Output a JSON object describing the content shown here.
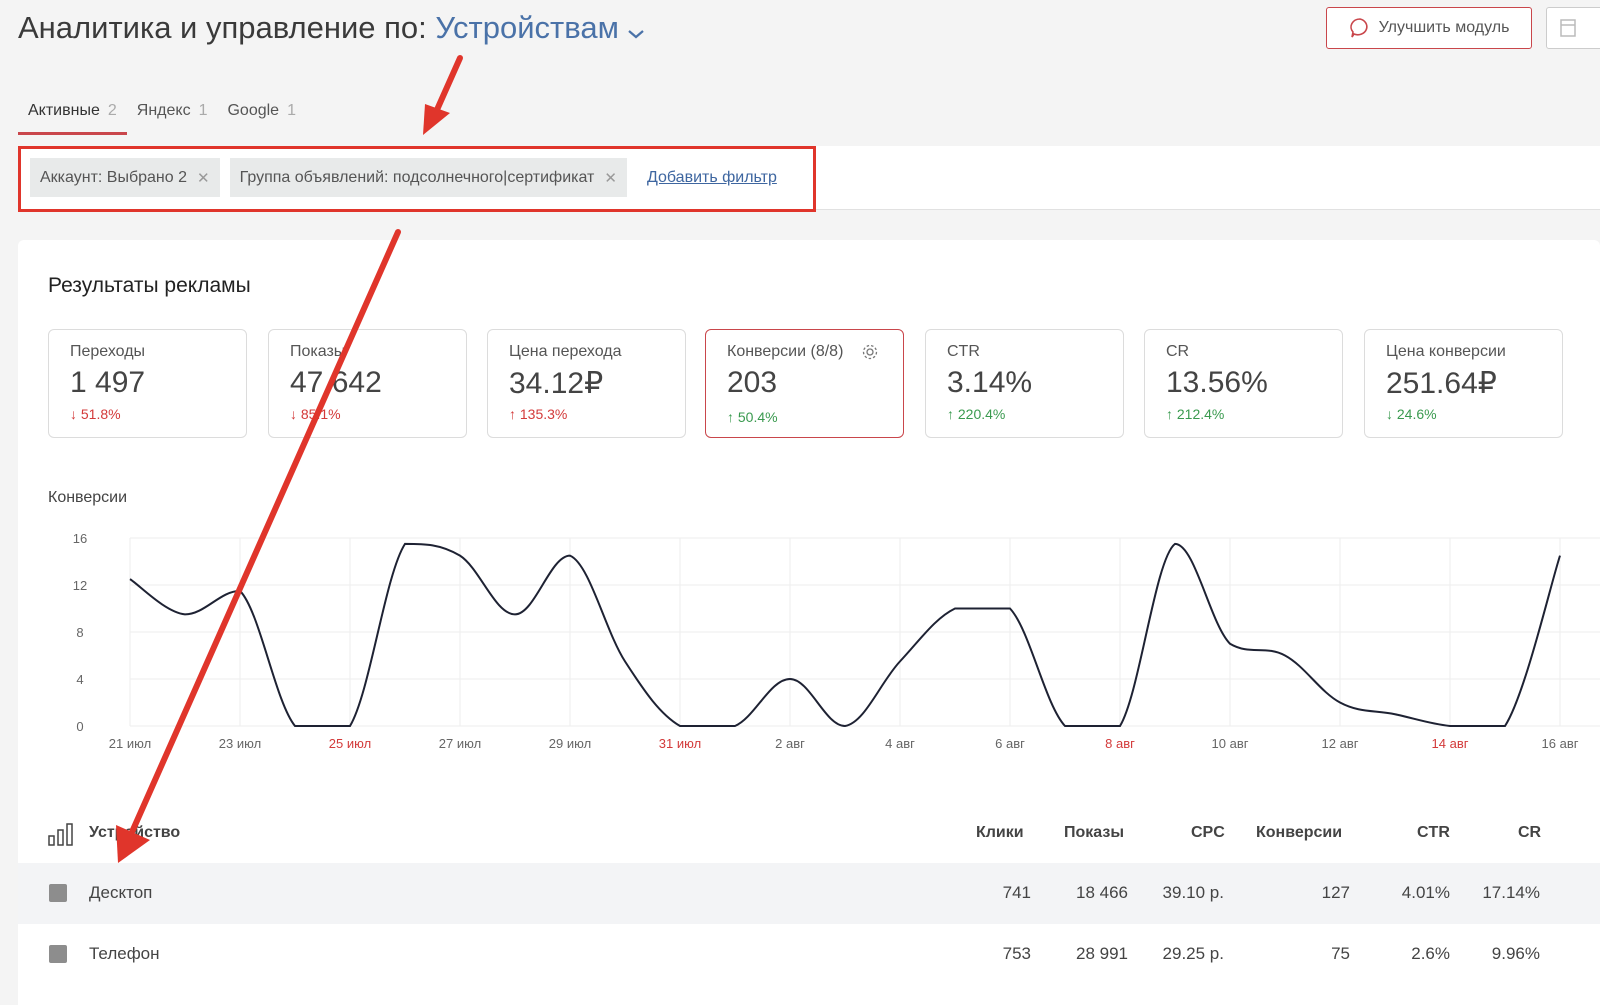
{
  "header": {
    "title_prefix": "Аналитика и управление по:",
    "dimension": "Устройствам",
    "improve_button": "Улучшить модуль"
  },
  "tabs": [
    {
      "label": "Активные",
      "count": "2"
    },
    {
      "label": "Яндекс",
      "count": "1"
    },
    {
      "label": "Google",
      "count": "1"
    }
  ],
  "filters": {
    "chips": [
      "Аккаунт: Выбрано 2",
      "Группа объявлений: подсолнечного|сертификат"
    ],
    "add_label": "Добавить фильтр"
  },
  "results": {
    "title": "Результаты рекламы",
    "kpis": [
      {
        "label": "Переходы",
        "value": "1 497",
        "delta": "51.8%",
        "dir": "down"
      },
      {
        "label": "Показы",
        "value": "47 642",
        "delta": "85.1%",
        "dir": "down"
      },
      {
        "label": "Цена перехода",
        "value": "34.12₽",
        "delta": "135.3%",
        "dir": "up_red"
      },
      {
        "label": "Конверсии (8/8)",
        "value": "203",
        "delta": "50.4%",
        "dir": "up"
      },
      {
        "label": "CTR",
        "value": "3.14%",
        "delta": "220.4%",
        "dir": "up"
      },
      {
        "label": "CR",
        "value": "13.56%",
        "delta": "212.4%",
        "dir": "up"
      },
      {
        "label": "Цена конверсии",
        "value": "251.64₽",
        "delta": "24.6%",
        "dir": "down_green"
      }
    ]
  },
  "chart_data": {
    "type": "line",
    "title": "Конверсии",
    "x": [
      "21 июл",
      "22 июл",
      "23 июл",
      "24 июл",
      "25 июл",
      "26 июл",
      "27 июл",
      "28 июл",
      "29 июл",
      "30 июл",
      "31 июл",
      "1 авг",
      "2 авг",
      "3 авг",
      "4 авг",
      "5 авг",
      "6 авг",
      "7 авг",
      "8 авг",
      "9 авг",
      "10 авг",
      "11 авг",
      "12 авг",
      "13 авг",
      "14 авг",
      "15 авг",
      "16 авг"
    ],
    "tick_labels": [
      "21 июл",
      "23 июл",
      "25 июл",
      "27 июл",
      "29 июл",
      "31 июл",
      "2 авг",
      "4 авг",
      "6 авг",
      "8 авг",
      "10 авг",
      "12 авг",
      "14 авг",
      "16 авг"
    ],
    "weekend_ticks": [
      "25 июл",
      "31 июл",
      "8 авг",
      "14 авг"
    ],
    "series": [
      {
        "values": [
          12.5,
          9.5,
          11.5,
          0,
          0,
          15.5,
          14.5,
          9.5,
          14.5,
          5.5,
          0,
          0,
          4,
          0,
          5.5,
          10,
          10,
          0,
          0,
          15.5,
          7,
          6,
          2,
          1,
          0,
          0,
          14.5
        ]
      }
    ],
    "ylim": [
      0,
      16
    ],
    "yticks": [
      0,
      4,
      8,
      12,
      16
    ],
    "grid": true
  },
  "table": {
    "headers": [
      "Устройство",
      "Клики",
      "Показы",
      "CPC",
      "Конверсии",
      "CTR",
      "CR"
    ],
    "rows": [
      {
        "name": "Десктоп",
        "clicks": "741",
        "shows": "18 466",
        "cpc": "39.10 р.",
        "conv": "127",
        "ctr": "4.01%",
        "cr": "17.14%"
      },
      {
        "name": "Телефон",
        "clicks": "753",
        "shows": "28 991",
        "cpc": "29.25 р.",
        "conv": "75",
        "ctr": "2.6%",
        "cr": "9.96%"
      }
    ]
  },
  "colors": {
    "accent": "#c9464b",
    "link": "#4a72a8",
    "annotation": "#e0352b",
    "up": "#3a9a4f",
    "down": "#d33a3a"
  }
}
